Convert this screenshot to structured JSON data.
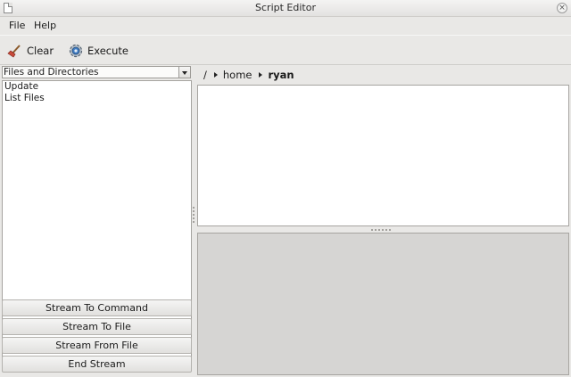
{
  "window": {
    "title": "Script Editor"
  },
  "menu": {
    "items": [
      "File",
      "Help"
    ]
  },
  "toolbar": {
    "clear_label": "Clear",
    "execute_label": "Execute"
  },
  "left": {
    "category_selected": "Files and Directories",
    "scripts": [
      "Update",
      "List Files"
    ],
    "buttons": [
      "Stream To Command",
      "Stream To File",
      "Stream From File",
      "End Stream"
    ]
  },
  "path": {
    "segments": [
      "/",
      "home",
      "ryan"
    ]
  },
  "colors": {
    "window_bg": "#e9e8e6",
    "output_bg": "#d6d5d3"
  },
  "icons": {
    "window": "document-icon",
    "close": "close-icon",
    "clear": "broom-icon",
    "execute": "gear-icon"
  }
}
